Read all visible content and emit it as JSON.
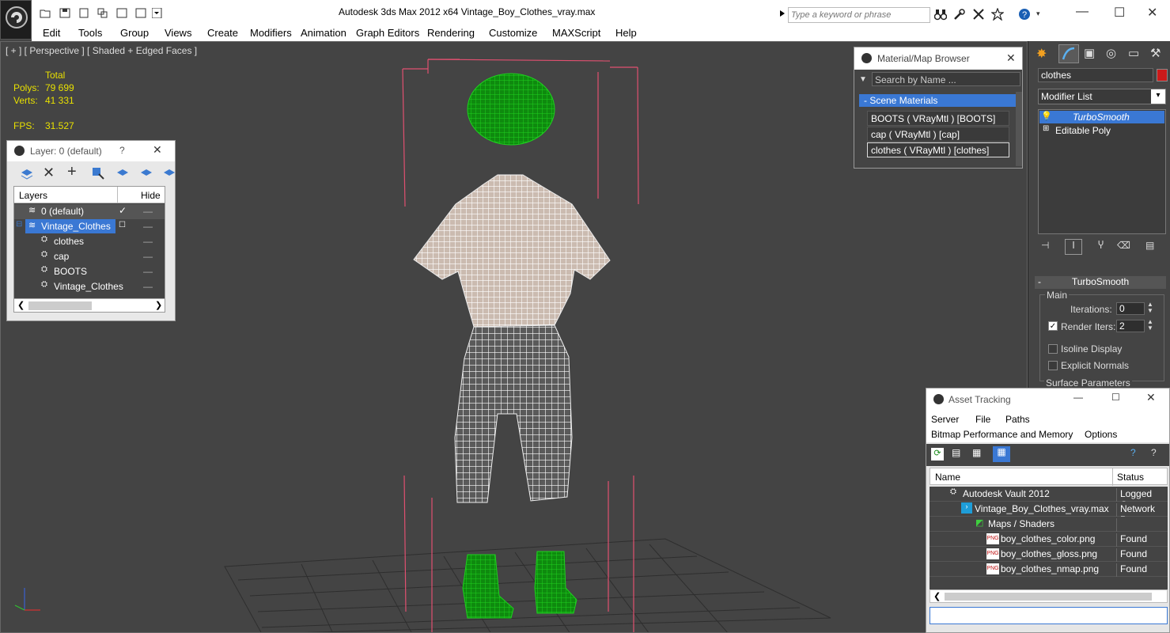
{
  "title_bar": {
    "title": "Autodesk 3ds Max  2012 x64        Vintage_Boy_Clothes_vray.max",
    "search_placeholder": "Type a keyword or phrase"
  },
  "menu": [
    "Edit",
    "Tools",
    "Group",
    "Views",
    "Create",
    "Modifiers",
    "Animation",
    "Graph Editors",
    "Rendering",
    "Customize",
    "MAXScript",
    "Help"
  ],
  "viewport": {
    "label": "[ + ] [ Perspective ] [ Shaded + Edged Faces ]",
    "stats": {
      "total_label": "Total",
      "polys_label": "Polys:",
      "polys_value": "79 699",
      "verts_label": "Verts:",
      "verts_value": "41 331",
      "fps_label": "FPS:",
      "fps_value": "31.527"
    }
  },
  "layer_dialog": {
    "title": "Layer: 0 (default)",
    "help": "?",
    "col_layers": "Layers",
    "col_hide": "Hide",
    "rows": [
      {
        "label": "0 (default)",
        "indent": 0
      },
      {
        "label": "Vintage_Clothes",
        "indent": 0
      },
      {
        "label": "clothes",
        "indent": 1
      },
      {
        "label": "cap",
        "indent": 1
      },
      {
        "label": "BOOTS",
        "indent": 1
      },
      {
        "label": "Vintage_Clothes",
        "indent": 1
      }
    ]
  },
  "material_browser": {
    "title": "Material/Map Browser",
    "search_placeholder": "Search by Name ...",
    "group": "- Scene Materials",
    "items": [
      "BOOTS  ( VRayMtl ) [BOOTS]",
      "cap  ( VRayMtl ) [cap]",
      "clothes  ( VRayMtl ) [clothes]"
    ]
  },
  "command_panel": {
    "object_name": "clothes",
    "modifier_list": "Modifier List",
    "stack": [
      "TurboSmooth",
      "Editable Poly"
    ],
    "rollout_title": "TurboSmooth",
    "main_group": "Main",
    "iterations_label": "Iterations:",
    "iterations_value": "0",
    "render_iters_label": "Render Iters:",
    "render_iters_value": "2",
    "isoline_label": "Isoline Display",
    "explicit_normals_label": "Explicit Normals",
    "surface_params": "Surface Parameters",
    "colors": {
      "object_color": "#cc1a1a"
    }
  },
  "asset_tracking": {
    "title": "Asset Tracking",
    "menu_row1": [
      "Server",
      "File",
      "Paths"
    ],
    "menu_row2": [
      "Bitmap Performance and Memory",
      "Options"
    ],
    "col_name": "Name",
    "col_status": "Status",
    "rows": [
      {
        "name": "Autodesk Vault 2012",
        "status": "Logged Out",
        "indent": 1
      },
      {
        "name": "Vintage_Boy_Clothes_vray.max",
        "status": "Network Pat",
        "indent": 2
      },
      {
        "name": "Maps / Shaders",
        "status": "",
        "indent": 3
      },
      {
        "name": "boy_clothes_color.png",
        "status": "Found",
        "indent": 4
      },
      {
        "name": "boy_clothes_gloss.png",
        "status": "Found",
        "indent": 4
      },
      {
        "name": "boy_clothes_nmap.png",
        "status": "Found",
        "indent": 4
      }
    ]
  }
}
